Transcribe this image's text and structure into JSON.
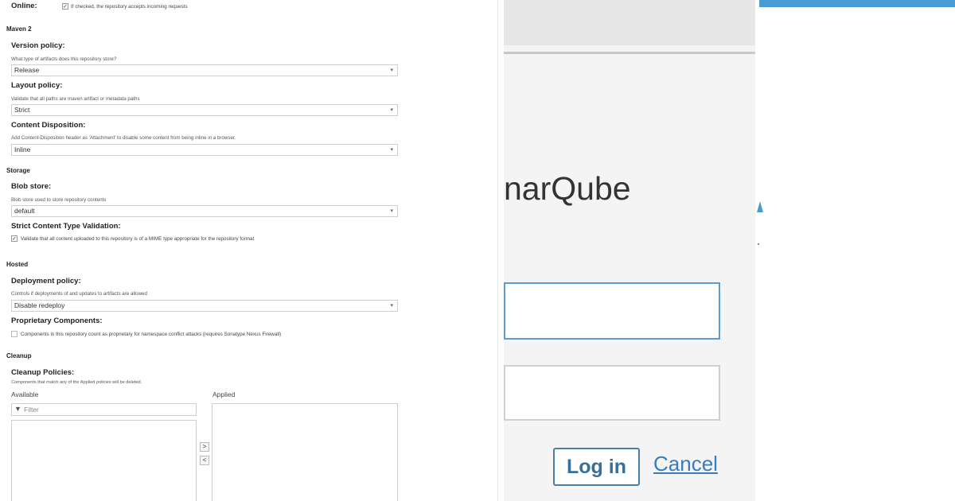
{
  "left": {
    "online_label": "Online:",
    "online_help": "If checked, the repository accepts incoming requests",
    "maven_section": "Maven 2",
    "version_policy_label": "Version policy:",
    "version_policy_help": "What type of artifacts does this repository store?",
    "version_policy_value": "Release",
    "layout_policy_label": "Layout policy:",
    "layout_policy_help": "Validate that all paths are maven artifact or metadata paths",
    "layout_policy_value": "Strict",
    "content_disposition_label": "Content Disposition:",
    "content_disposition_help": "Add Content-Disposition header as 'Attachment' to disable some content from being inline in a browser.",
    "content_disposition_value": "Inline",
    "storage_section": "Storage",
    "blob_store_label": "Blob store:",
    "blob_store_help": "Blob store used to store repository contents",
    "blob_store_value": "default",
    "strict_validation_label": "Strict Content Type Validation:",
    "strict_validation_help": "Validate that all content uploaded to this repository is of a MIME type appropriate for the repository format",
    "hosted_section": "Hosted",
    "deployment_policy_label": "Deployment policy:",
    "deployment_policy_help": "Controls if deployments of and updates to artifacts are allowed",
    "deployment_policy_value": "Disable redeploy",
    "proprietary_label": "Proprietary Components:",
    "proprietary_help": "Components in this repository count as proprietary for namespace conflict attacks (requires Sonatype Nexus Firewall)",
    "cleanup_section": "Cleanup",
    "cleanup_policies_label": "Cleanup Policies:",
    "cleanup_policies_help": "Components that match any of the Applied policies will be deleted.",
    "available_label": "Available",
    "applied_label": "Applied",
    "filter_placeholder": "Filter",
    "move_right": ">",
    "move_left": "<",
    "check_mark": "✓",
    "caret": "▾"
  },
  "right": {
    "brand_text": "narQube",
    "login_button": "Log in",
    "cancel_link": "Cancel"
  },
  "colors": {
    "accent_blue": "#4a9bd1",
    "link_blue": "#3a7bbf",
    "field_border_focus": "#5b9bd0"
  }
}
